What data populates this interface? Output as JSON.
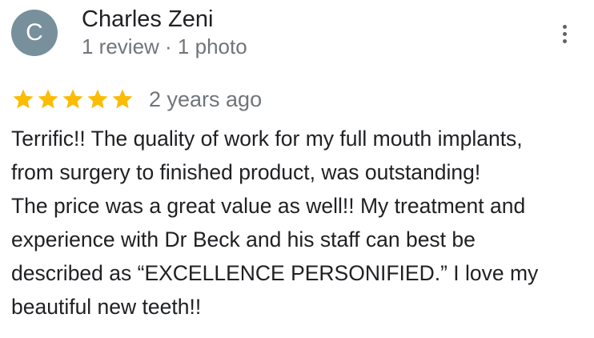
{
  "reviewer": {
    "avatar_letter": "C",
    "avatar_color": "#78909c",
    "name": "Charles Zeni",
    "meta": "1 review · 1 photo"
  },
  "more_menu": {
    "icon": "more-vert-icon"
  },
  "rating": {
    "stars": 5,
    "max_stars": 5,
    "star_color": "#fbbc04",
    "date": "2 years ago"
  },
  "review": {
    "text": "Terrific!! The quality of work for my full mouth implants,\nfrom surgery to finished product, was outstanding!\nThe price was a great value as well!!  My treatment and\nexperience with Dr Beck and his staff can best be\ndescribed as “EXCELLENCE PERSONIFIED.”  I love my\nbeautiful new teeth!!"
  }
}
